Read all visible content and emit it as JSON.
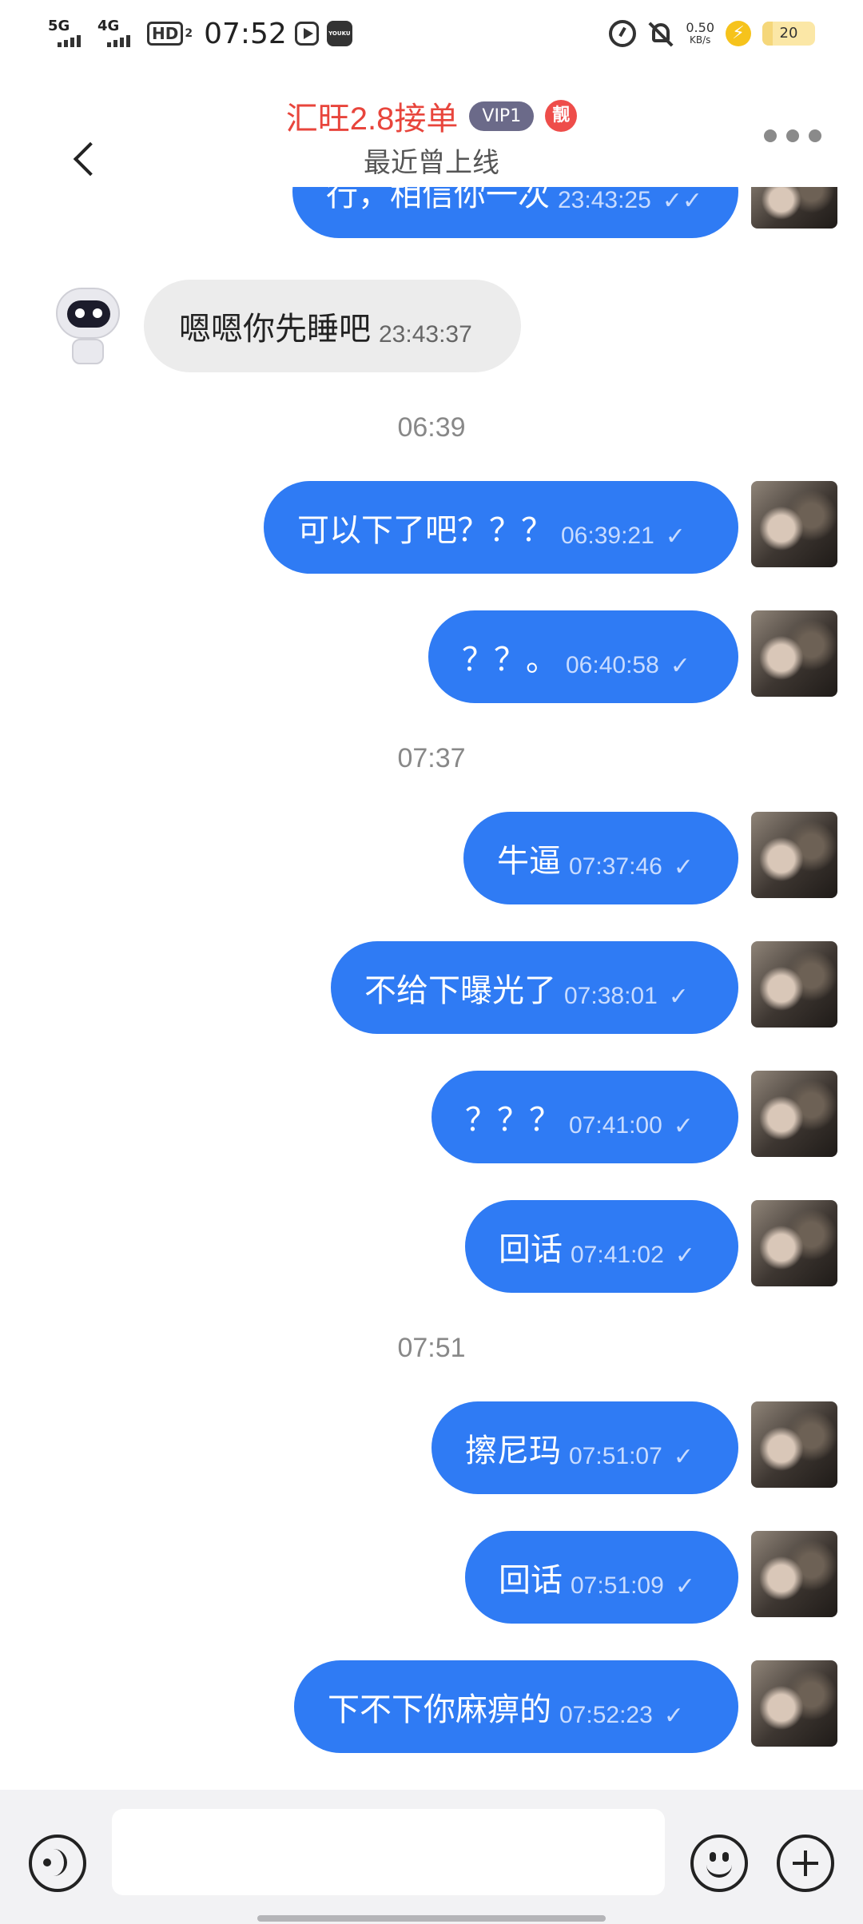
{
  "status_bar": {
    "net1": "5G",
    "net2": "4G",
    "hd": "HD",
    "hd_sub": "2",
    "time": "07:52",
    "app_icon": "YOUKU",
    "speed_value": "0.50",
    "speed_unit": "KB/s",
    "battery": "20",
    "battery_level": 0.2,
    "icons": [
      "signal-icon",
      "play-icon",
      "youku-icon",
      "alarm-icon",
      "mute-icon",
      "charging-icon",
      "battery-icon"
    ]
  },
  "header": {
    "title": "汇旺2.8接单",
    "vip": "VIP1",
    "badge": "靓",
    "subtitle": "最近曾上线",
    "accent": "#e8453c"
  },
  "messages": {
    "partial_out": {
      "text": "行，相信你一次",
      "time": "23:43:25"
    },
    "in_1": {
      "text": "嗯嗯你先睡吧",
      "time": "23:43:37"
    },
    "divider_1": "06:39",
    "m1": {
      "text": "可以下了吧？？？",
      "time": "06:39:21"
    },
    "m2": {
      "text": "？？。",
      "time": "06:40:58"
    },
    "divider_2": "07:37",
    "m3": {
      "text": "牛逼",
      "time": "07:37:46"
    },
    "m4": {
      "text": "不给下曝光了",
      "time": "07:38:01"
    },
    "m5": {
      "text": "？？？",
      "time": "07:41:00"
    },
    "m6": {
      "text": "回话",
      "time": "07:41:02"
    },
    "divider_3": "07:51",
    "m7": {
      "text": "擦尼玛",
      "time": "07:51:07"
    },
    "m8": {
      "text": "回话",
      "time": "07:51:09"
    },
    "m9": {
      "text": "下不下你麻痹的",
      "time": "07:52:23"
    },
    "single_tick": "✓",
    "double_tick": "✓✓",
    "bubble_color": "#2f7bf4"
  },
  "input_bar": {
    "placeholder": "",
    "icons": [
      "voice-icon",
      "emoji-icon",
      "plus-icon"
    ]
  }
}
